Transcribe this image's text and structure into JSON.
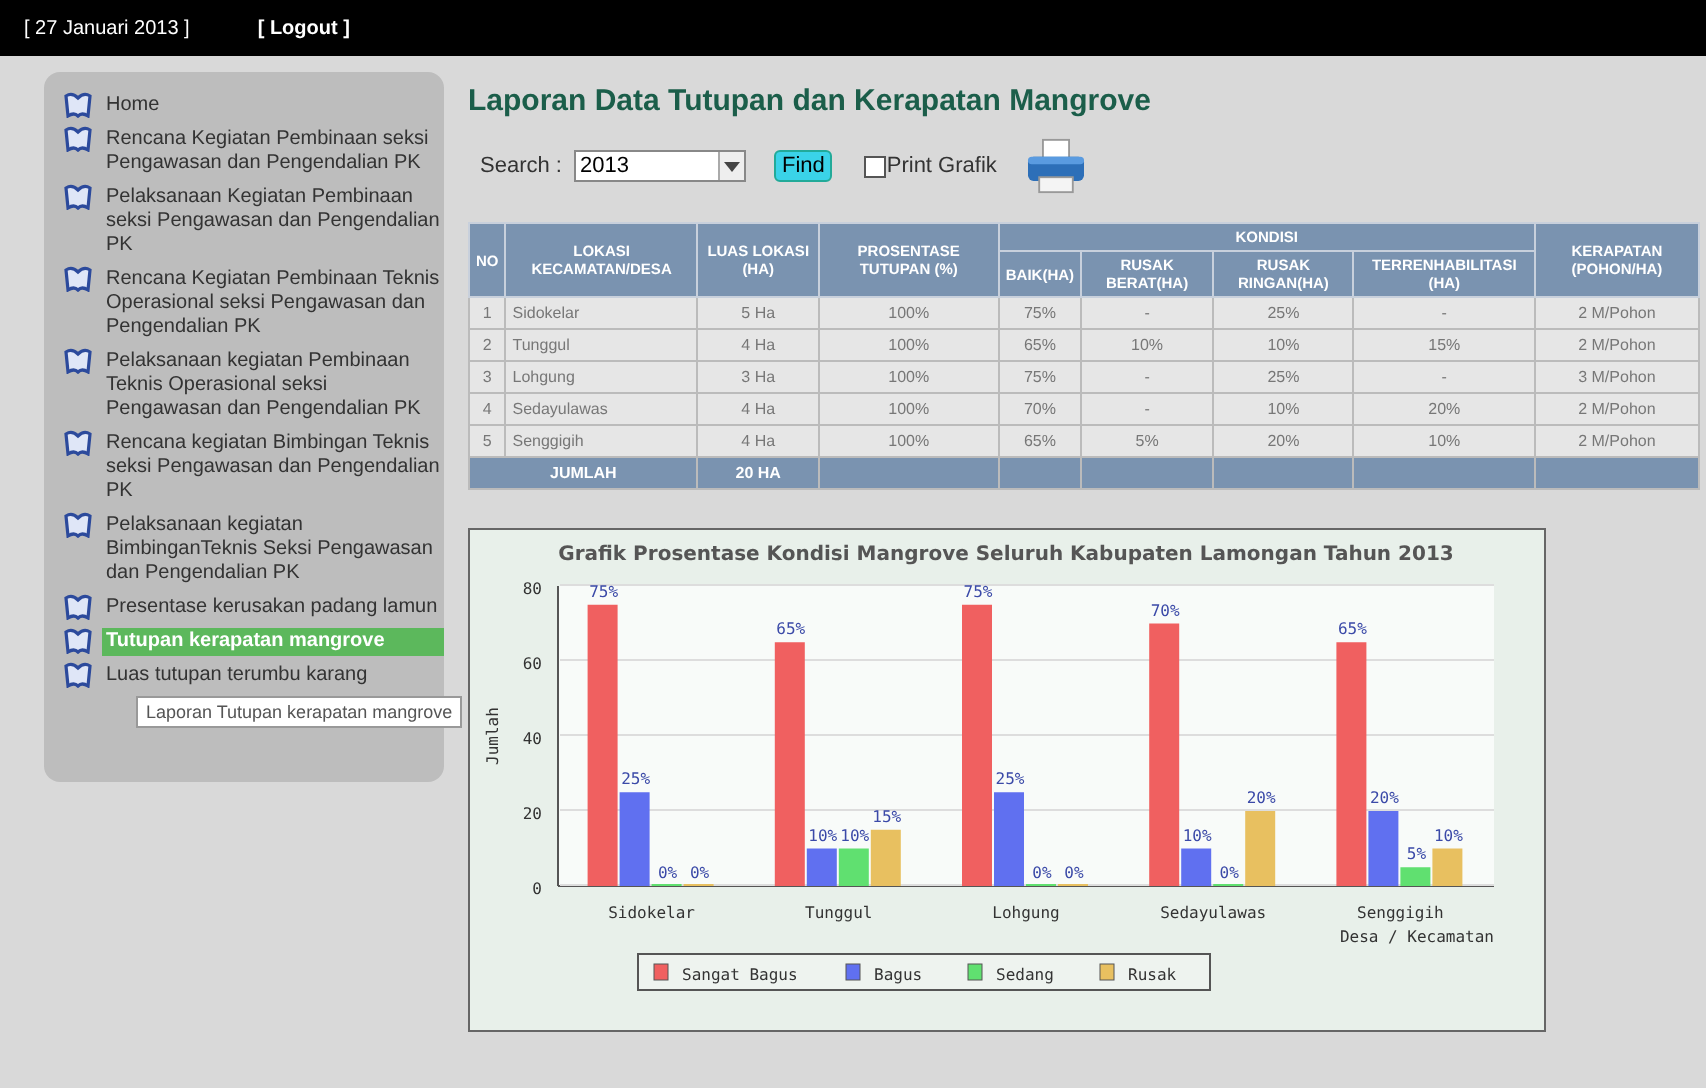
{
  "top_bar": {
    "date": "[ 27 Januari 2013 ]",
    "logout": "[ Logout ]"
  },
  "sidebar": {
    "items": [
      {
        "label": "Home",
        "selected": false
      },
      {
        "label": "Rencana Kegiatan Pembinaan seksi Pengawasan dan Pengendalian PK",
        "selected": false
      },
      {
        "label": "Pelaksanaan Kegiatan Pembinaan seksi Pengawasan dan Pengendalian PK",
        "selected": false
      },
      {
        "label": "Rencana Kegiatan Pembinaan Teknis Operasional seksi Pengawasan dan Pengendalian PK",
        "selected": false
      },
      {
        "label": "Pelaksanaan kegiatan Pembinaan Teknis Operasional seksi Pengawasan dan Pengendalian PK",
        "selected": false
      },
      {
        "label": "Rencana kegiatan Bimbingan Teknis seksi Pengawasan dan Pengendalian PK",
        "selected": false
      },
      {
        "label": "Pelaksanaan kegiatan BimbinganTeknis Seksi Pengawasan dan Pengendalian PK",
        "selected": false
      },
      {
        "label": "Presentase kerusakan padang lamun",
        "selected": false
      },
      {
        "label": "Tutupan kerapatan mangrove",
        "selected": true
      },
      {
        "label": "Luas tutupan terumbu karang",
        "selected": false
      }
    ],
    "tooltip": "Laporan Tutupan kerapatan mangrove"
  },
  "page_title": "Laporan Data Tutupan dan Kerapatan Mangrove",
  "search": {
    "label": "Search :",
    "value": "2013",
    "find": "Find",
    "print_label": "Print Grafik",
    "print_checked": false
  },
  "table": {
    "group_header": "KONDISI",
    "columns": [
      {
        "label": "NO",
        "kind": "single"
      },
      {
        "label": "LOKASI KECAMATAN/DESA",
        "kind": "single"
      },
      {
        "label": "LUAS LOKASI (HA)",
        "kind": "single"
      },
      {
        "label": "PROSENTASE TUTUPAN (%)",
        "kind": "single"
      },
      {
        "label": "BAIK(HA)",
        "kind": "sub"
      },
      {
        "label": "RUSAK BERAT(HA)",
        "kind": "sub"
      },
      {
        "label": "RUSAK RINGAN(HA)",
        "kind": "sub"
      },
      {
        "label": "TERRENHABILITASI (HA)",
        "kind": "sub"
      },
      {
        "label": "KERAPATAN (POHON/HA)",
        "kind": "single"
      }
    ],
    "rows": [
      [
        "1",
        "Sidokelar",
        "5 Ha",
        "100%",
        "75%",
        "-",
        "25%",
        "-",
        "2 M/Pohon"
      ],
      [
        "2",
        "Tunggul",
        "4 Ha",
        "100%",
        "65%",
        "10%",
        "10%",
        "15%",
        "2 M/Pohon"
      ],
      [
        "3",
        "Lohgung",
        "3 Ha",
        "100%",
        "75%",
        "-",
        "25%",
        "-",
        "3 M/Pohon"
      ],
      [
        "4",
        "Sedayulawas",
        "4 Ha",
        "100%",
        "70%",
        "-",
        "10%",
        "20%",
        "2 M/Pohon"
      ],
      [
        "5",
        "Senggigih",
        "4 Ha",
        "100%",
        "65%",
        "5%",
        "20%",
        "10%",
        "2 M/Pohon"
      ]
    ],
    "footer": {
      "label": "JUMLAH",
      "total": "20 HA"
    }
  },
  "chart": {
    "chart_data": {
      "type": "bar",
      "title": "Grafik Prosentase Kondisi Mangrove Seluruh Kabupaten Lamongan Tahun 2013",
      "xlabel": "Desa / Kecamatan",
      "ylabel": "Jumlah",
      "categories": [
        "Sidokelar",
        "Tunggul",
        "Lohgung",
        "Sedayulawas",
        "Senggigih"
      ],
      "series": [
        {
          "name": "Sangat Bagus",
          "color": "#f06060",
          "values": [
            75,
            65,
            75,
            70,
            65
          ],
          "value_labels": [
            "75%",
            "65%",
            "75%",
            "70%",
            "65%"
          ]
        },
        {
          "name": "Bagus",
          "color": "#6070f0",
          "values": [
            25,
            10,
            25,
            10,
            20
          ],
          "value_labels": [
            "25%",
            "10%",
            "25%",
            "10%",
            "20%"
          ]
        },
        {
          "name": "Sedang",
          "color": "#60e070",
          "values": [
            0,
            10,
            0,
            0,
            5
          ],
          "value_labels": [
            "0%",
            "10%",
            "0%",
            "0%",
            "5%"
          ]
        },
        {
          "name": "Rusak",
          "color": "#e8c060",
          "values": [
            0,
            15,
            0,
            20,
            10
          ],
          "value_labels": [
            "0%",
            "15%",
            "0%",
            "20%",
            "10%"
          ]
        }
      ],
      "ylim": [
        0,
        80
      ],
      "yticks": [
        0,
        20,
        40,
        60,
        80
      ],
      "grid": true,
      "legend": true
    }
  }
}
